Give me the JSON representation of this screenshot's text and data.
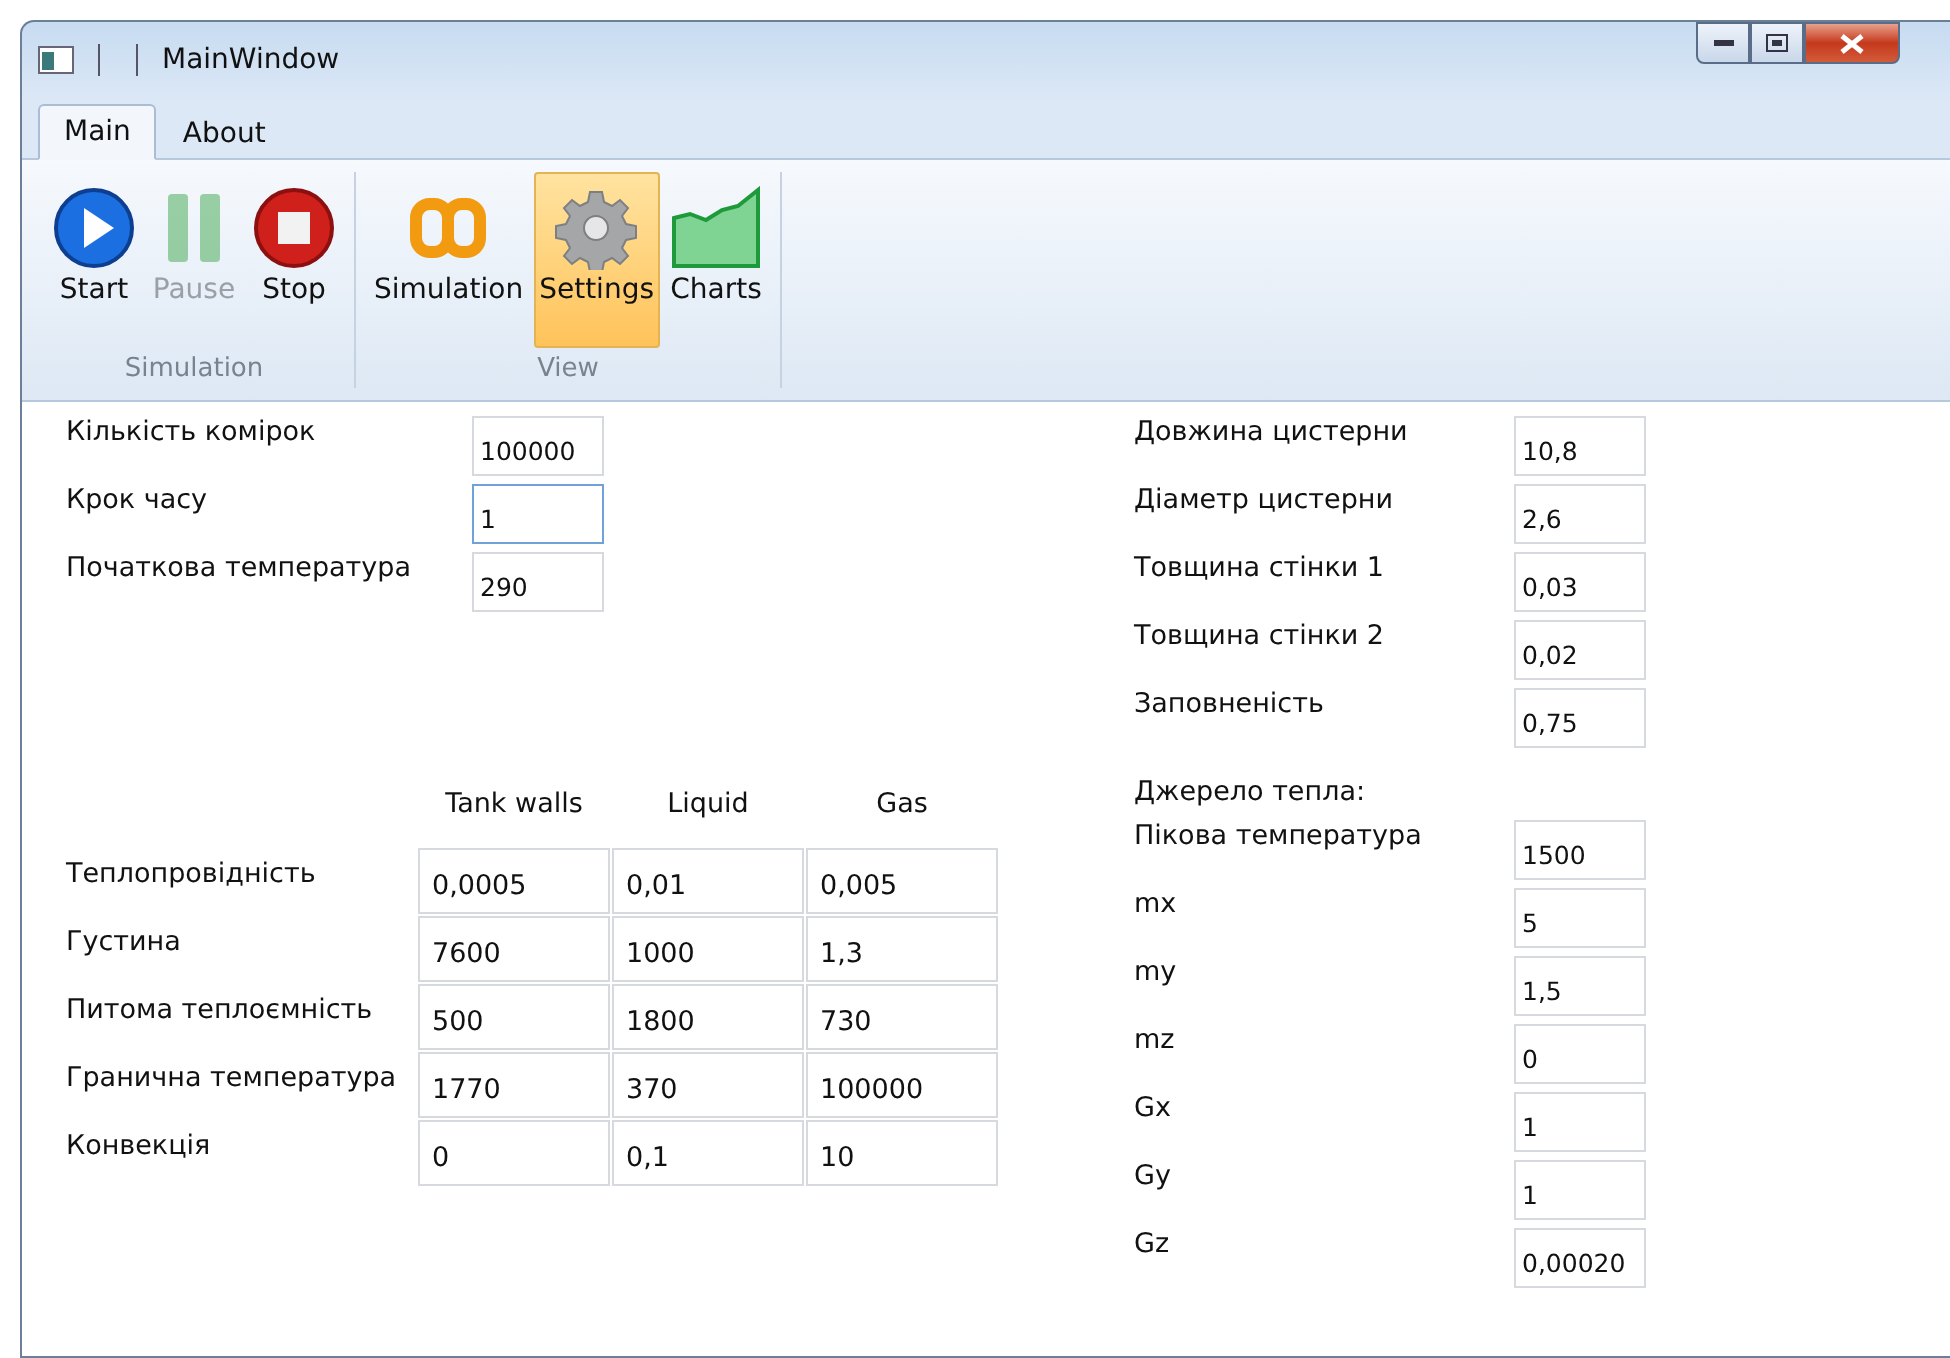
{
  "window": {
    "title": "MainWindow"
  },
  "tabs": [
    {
      "label": "Main",
      "selected": true
    },
    {
      "label": "About",
      "selected": false
    }
  ],
  "ribbon_groups": [
    {
      "label": "Simulation",
      "buttons": [
        {
          "kind": "start",
          "label": "Start",
          "disabled": false,
          "selected": false
        },
        {
          "kind": "pause",
          "label": "Pause",
          "disabled": true,
          "selected": false
        },
        {
          "kind": "stop",
          "label": "Stop",
          "disabled": false,
          "selected": false
        }
      ]
    },
    {
      "label": "View",
      "buttons": [
        {
          "kind": "simulation",
          "label": "Simulation",
          "disabled": false,
          "selected": false
        },
        {
          "kind": "settings",
          "label": "Settings",
          "disabled": false,
          "selected": true
        },
        {
          "kind": "charts",
          "label": "Charts",
          "disabled": false,
          "selected": false
        }
      ]
    }
  ],
  "general": [
    {
      "label": "Кількість комірок",
      "value": "100000",
      "focused": false
    },
    {
      "label": "Крок часу",
      "value": "1",
      "focused": true
    },
    {
      "label": "Початкова температура",
      "value": "290",
      "focused": false
    }
  ],
  "materials": {
    "columns": [
      "Tank walls",
      "Liquid",
      "Gas"
    ],
    "rows": [
      {
        "label": "Теплопровідність",
        "values": [
          "0,0005",
          "0,01",
          "0,005"
        ]
      },
      {
        "label": "Густина",
        "values": [
          "7600",
          "1000",
          "1,3"
        ]
      },
      {
        "label": "Питома теплоємність",
        "values": [
          "500",
          "1800",
          "730"
        ]
      },
      {
        "label": "Гранична температура",
        "values": [
          "1770",
          "370",
          "100000"
        ]
      },
      {
        "label": "Конвекція",
        "values": [
          "0",
          "0,1",
          "10"
        ]
      }
    ]
  },
  "tank": [
    {
      "label": "Довжина цистерни",
      "value": "10,8"
    },
    {
      "label": "Діаметр цистерни",
      "value": "2,6"
    },
    {
      "label": "Товщина стінки 1",
      "value": "0,03"
    },
    {
      "label": "Товщина стінки 2",
      "value": "0,02"
    },
    {
      "label": "Заповненість",
      "value": "0,75"
    }
  ],
  "heat_source": {
    "title": "Джерело тепла:",
    "fields": [
      {
        "label": "Пікова температура",
        "value": "1500"
      },
      {
        "label": "mx",
        "value": "5"
      },
      {
        "label": "my",
        "value": "1,5"
      },
      {
        "label": "mz",
        "value": "0"
      },
      {
        "label": "Gx",
        "value": "1"
      },
      {
        "label": "Gy",
        "value": "1"
      },
      {
        "label": "Gz",
        "value": "0,00020"
      }
    ]
  }
}
